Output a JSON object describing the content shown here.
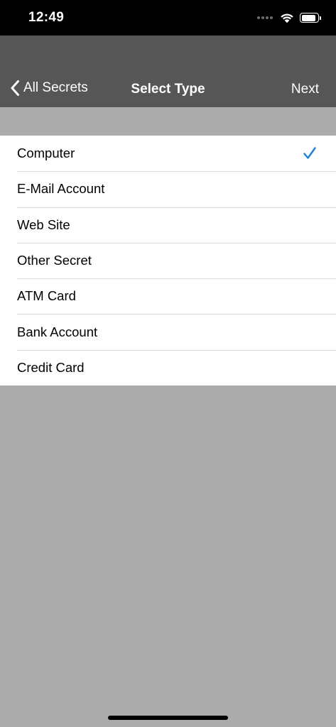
{
  "status_bar": {
    "time": "12:49",
    "battery_level": 0.9
  },
  "nav": {
    "back_label": "All Secrets",
    "title": "Select Type",
    "next_label": "Next"
  },
  "list": {
    "items": [
      {
        "label": "Computer",
        "selected": true
      },
      {
        "label": "E-Mail Account",
        "selected": false
      },
      {
        "label": "Web Site",
        "selected": false
      },
      {
        "label": "Other Secret",
        "selected": false
      },
      {
        "label": "ATM Card",
        "selected": false
      },
      {
        "label": "Bank Account",
        "selected": false
      },
      {
        "label": "Credit Card",
        "selected": false
      }
    ]
  },
  "colors": {
    "accent": "#1a7fe0",
    "nav_background": "#565656",
    "page_background": "#ababab"
  },
  "icons": {
    "back": "chevron-left-icon",
    "selected": "checkmark-icon",
    "wifi": "wifi-icon",
    "battery": "battery-icon",
    "cellular": "cellular-signal-icon"
  }
}
